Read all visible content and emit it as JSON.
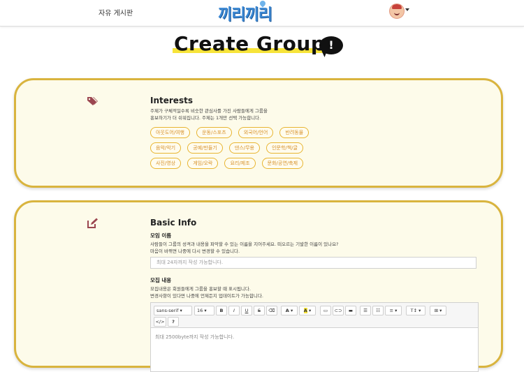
{
  "header": {
    "nav_link": "자유 게시판",
    "logo_text": "끼리끼리",
    "avatar_icon": "user-avatar-icon"
  },
  "page": {
    "title": "Create Group",
    "title_bubble": "!"
  },
  "interests": {
    "heading": "Interests",
    "icon": "tags-icon",
    "desc_line1": "주제가 구체적일수록 비슷한 관심사를 가진 사람들에게 그룹을",
    "desc_line2": "홍보하기가 더 쉬워집니다. 주제는 1개만 선택 가능합니다.",
    "chips": [
      "아웃도어/여행",
      "운동/스포츠",
      "외국어/언어",
      "반려동물",
      "음악/악기",
      "공예/만들기",
      "댄스/무용",
      "인문학/책/글",
      "사진/영상",
      "게임/오락",
      "요리/제조",
      "문화/공연/축제"
    ]
  },
  "basic_info": {
    "heading": "Basic Info",
    "icon": "edit-icon",
    "name_label": "모임 이름",
    "name_desc_line1": "사람들이 그룹의 성격과 내용을 파악할 수 있는 이름을 지어주세요. 떠오르는 기발한 이름이 있나요?",
    "name_desc_line2": "마음이 바뀌면 나중에 다시 변경할 수 있습니다.",
    "name_placeholder": "최대 24자까지 작성 가능합니다.",
    "content_label": "모집 내용",
    "content_desc_line1": "모집내용은 회원들에게 그룹을 홍보할 때 표시됩니다.",
    "content_desc_line2": "변경사항이 있다면 나중에 언제든지 업데이트가 가능합니다.",
    "editor": {
      "font_family": "sans-serif",
      "font_size": "16",
      "bold": "B",
      "italic": "I",
      "underline": "U",
      "strike": "S",
      "clear": "⌫",
      "font_color": "A",
      "highlight": "A",
      "image": "▭",
      "link": "⊂⊃",
      "video": "▬",
      "ul": "☰",
      "ol": "☷",
      "align": "≡",
      "height": "T↕",
      "table": "⊞",
      "code": "</>",
      "help": "?",
      "placeholder": "최대 2500byte까지 작성 가능합니다."
    }
  },
  "colors": {
    "accent_gold": "#d9b43e",
    "chip_text": "#d7912a",
    "card_bg": "#fdfbea",
    "highlight_yellow": "#f7e43a",
    "logo_blue": "#3b88d4",
    "icon_maroon": "#9b4650"
  }
}
